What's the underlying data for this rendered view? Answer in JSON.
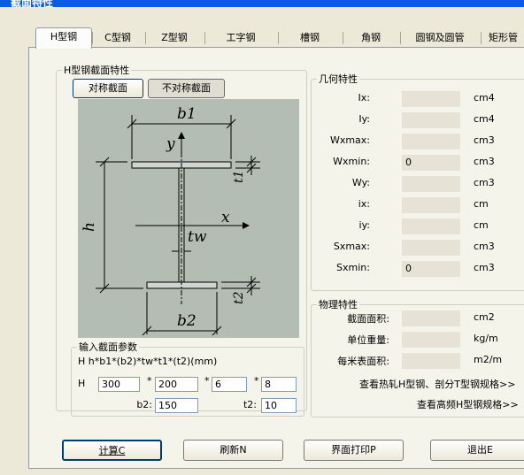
{
  "window": {
    "title": "截面特性"
  },
  "tabs": [
    {
      "label": "H型钢"
    },
    {
      "label": "C型钢"
    },
    {
      "label": "Z型钢"
    },
    {
      "label": "工字钢"
    },
    {
      "label": "槽钢"
    },
    {
      "label": "角钢"
    },
    {
      "label": "圆钢及圆管"
    },
    {
      "label": "矩形管"
    }
  ],
  "section": {
    "title": "H型钢截面特性",
    "symmetric_label": "对称截面",
    "asymmetric_label": "不对称截面"
  },
  "diagram": {
    "b1": "b1",
    "b2": "b2",
    "y": "y",
    "x": "x",
    "h": "h",
    "tw": "tw",
    "t1": "t1",
    "t2": "t2"
  },
  "input_params": {
    "title": "输入截面参数",
    "formula": "H   h*b1*(b2)*tw*t1*(t2)(mm)",
    "prefix": "H",
    "h": "300",
    "b1": "200",
    "tw": "6",
    "t1": "8",
    "b2_label": "b2:",
    "b2": "150",
    "t2_label": "t2:",
    "t2": "10",
    "sep": "*"
  },
  "geometry": {
    "title": "几何特性",
    "rows": [
      {
        "label": "Ix:",
        "value": "",
        "unit": "cm4"
      },
      {
        "label": "Iy:",
        "value": "",
        "unit": "cm4"
      },
      {
        "label": "Wxmax:",
        "value": "",
        "unit": "cm3"
      },
      {
        "label": "Wxmin:",
        "value": "0",
        "unit": "cm3"
      },
      {
        "label": "Wy:",
        "value": "",
        "unit": "cm3"
      },
      {
        "label": "ix:",
        "value": "",
        "unit": "cm"
      },
      {
        "label": "iy:",
        "value": "",
        "unit": "cm"
      },
      {
        "label": "Sxmax:",
        "value": "",
        "unit": "cm3"
      },
      {
        "label": "Sxmin:",
        "value": "0",
        "unit": "cm3"
      }
    ]
  },
  "physical": {
    "title": "物理特性",
    "rows": [
      {
        "label": "截面面积:",
        "value": "",
        "unit": "cm2"
      },
      {
        "label": "单位重量:",
        "value": "",
        "unit": "kg/m"
      },
      {
        "label": "每米表面积:",
        "value": "",
        "unit": "m2/m"
      }
    ],
    "link_hot": "查看热轧H型钢、剖分T型钢规格>>",
    "link_hf": "查看高频H型钢规格>>"
  },
  "buttons": {
    "calc": "计算C",
    "refresh": "刷新N",
    "print": "界面打印P",
    "exit": "退出E"
  }
}
